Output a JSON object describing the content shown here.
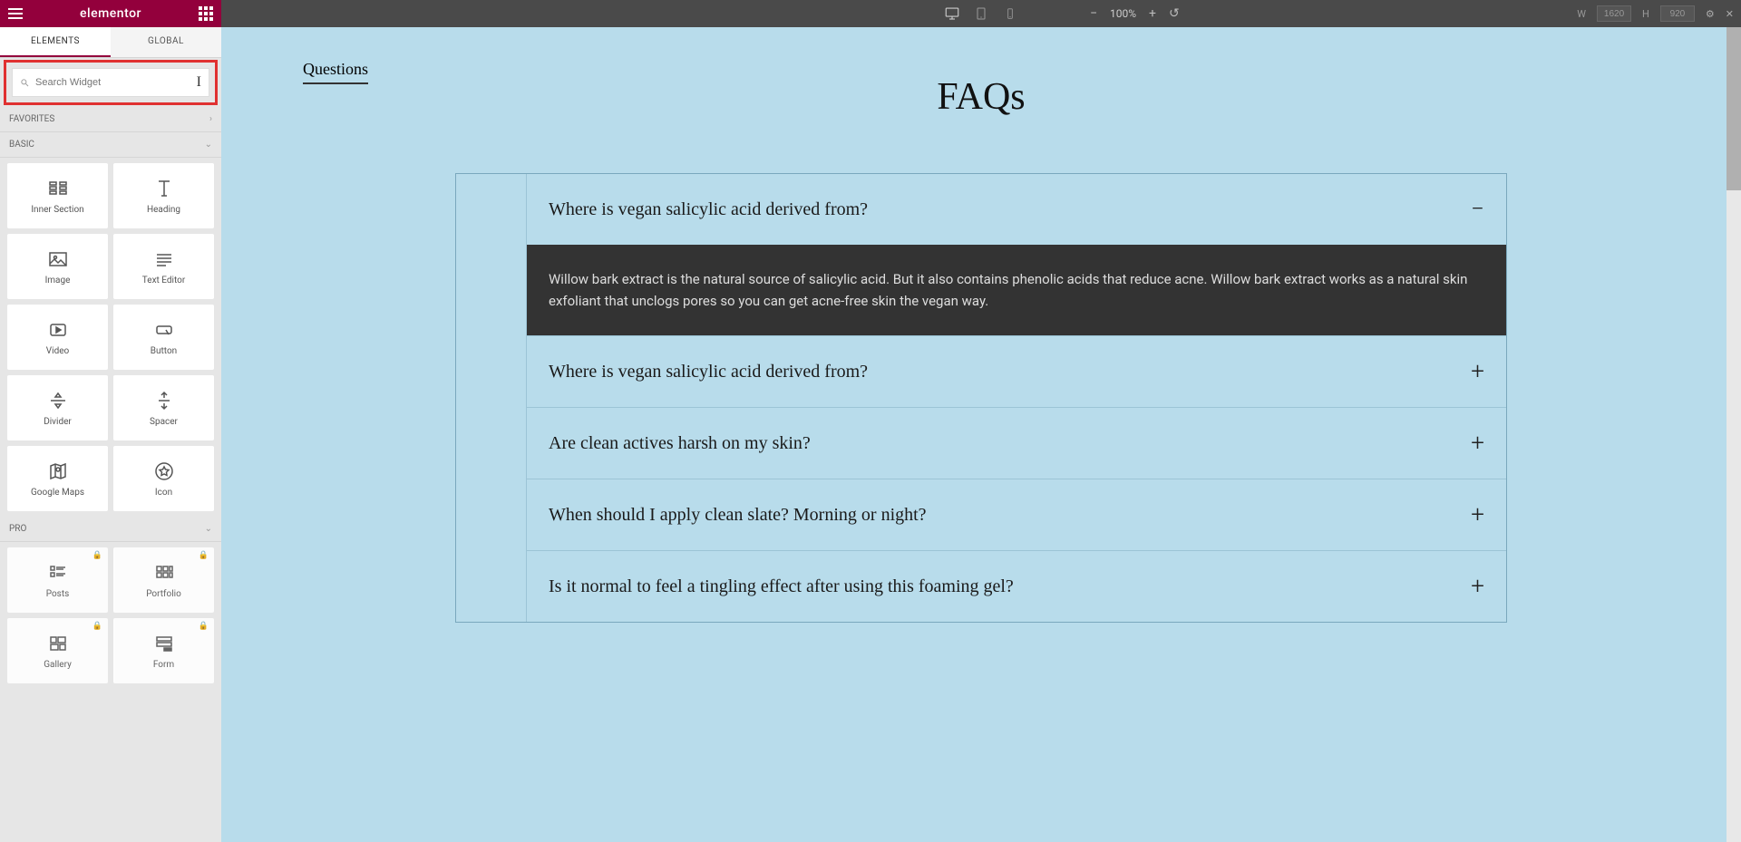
{
  "brand": "elementor",
  "tabs": {
    "elements": "ELEMENTS",
    "global": "GLOBAL"
  },
  "search": {
    "placeholder": "Search Widget"
  },
  "sections": {
    "favorites": "FAVORITES",
    "basic": "BASIC",
    "pro": "PRO"
  },
  "widgets": {
    "basic": [
      {
        "id": "inner-section",
        "label": "Inner Section"
      },
      {
        "id": "heading",
        "label": "Heading"
      },
      {
        "id": "image",
        "label": "Image"
      },
      {
        "id": "text-editor",
        "label": "Text Editor"
      },
      {
        "id": "video",
        "label": "Video"
      },
      {
        "id": "button",
        "label": "Button"
      },
      {
        "id": "divider",
        "label": "Divider"
      },
      {
        "id": "spacer",
        "label": "Spacer"
      },
      {
        "id": "google-maps",
        "label": "Google Maps"
      },
      {
        "id": "icon",
        "label": "Icon"
      }
    ],
    "pro": [
      {
        "id": "posts",
        "label": "Posts"
      },
      {
        "id": "portfolio",
        "label": "Portfolio"
      },
      {
        "id": "gallery",
        "label": "Gallery"
      },
      {
        "id": "form",
        "label": "Form"
      }
    ]
  },
  "topbar": {
    "zoom": "100%",
    "width_label": "W",
    "height_label": "H",
    "width_value": "1620",
    "height_value": "920"
  },
  "page": {
    "questions_label": "Questions",
    "faq_title": "FAQs",
    "faq_items": [
      {
        "q": "Where is vegan salicylic acid derived from?",
        "open": true,
        "a": "Willow bark extract is the natural source of salicylic acid. But it also contains phenolic acids that reduce acne. Willow bark extract works as a natural skin exfoliant that unclogs pores so you can get acne-free skin the vegan way."
      },
      {
        "q": "Where is vegan salicylic acid derived from?",
        "open": false
      },
      {
        "q": "Are clean actives harsh on my skin?",
        "open": false
      },
      {
        "q": "When should I apply clean slate? Morning or night?",
        "open": false
      },
      {
        "q": "Is it normal to feel a tingling effect after using this foaming gel?",
        "open": false
      }
    ]
  }
}
